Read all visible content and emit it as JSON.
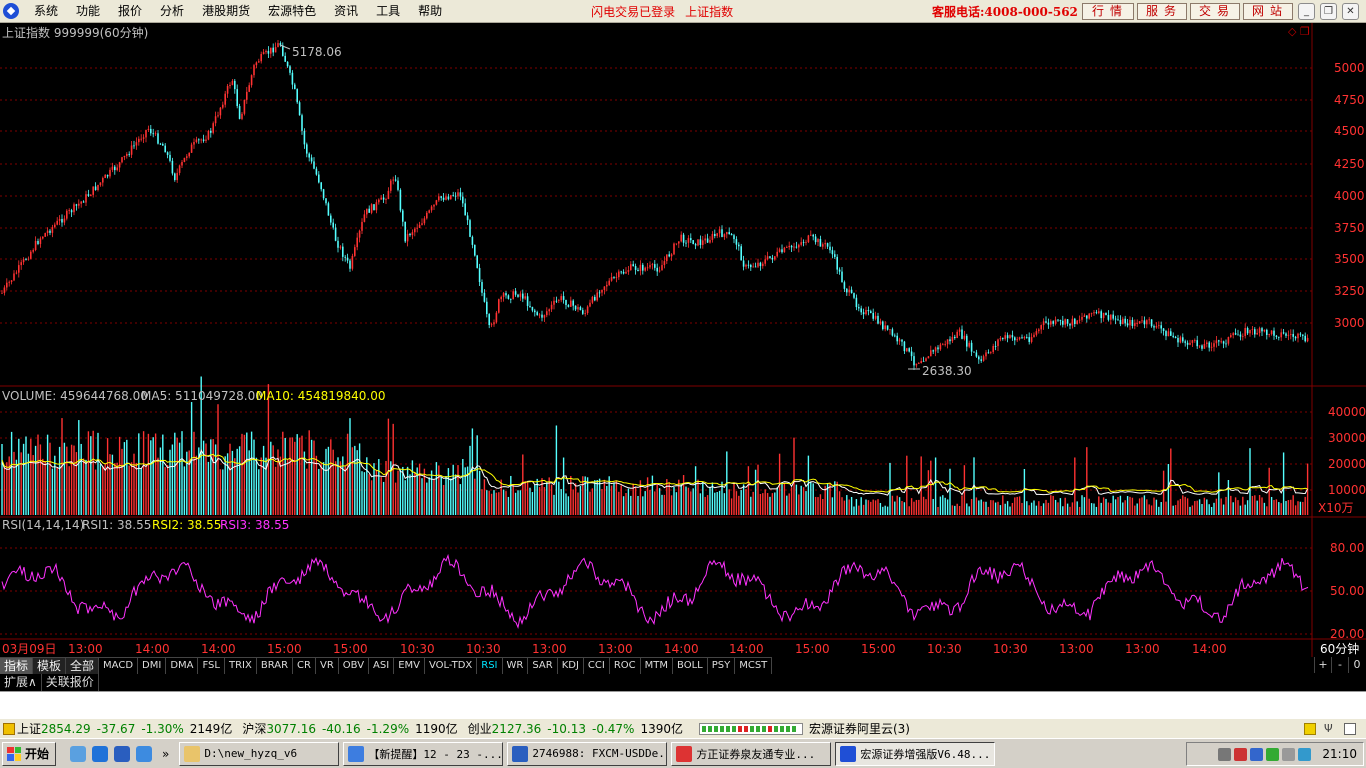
{
  "menubar": {
    "items": [
      "系统",
      "功能",
      "报价",
      "分析",
      "港股期货",
      "宏源特色",
      "资讯",
      "工具",
      "帮助"
    ],
    "login_status": "闪电交易已登录",
    "current_index": "上证指数",
    "hotline": "客服电话:4008-000-562",
    "quick_buttons": [
      "行情",
      "服务",
      "交易",
      "网站"
    ],
    "window_buttons": [
      "minimize",
      "restore",
      "close"
    ]
  },
  "price_panel": {
    "title": "上证指数 999999(60分钟)",
    "high_label": "5178.06",
    "low_label": "2638.30",
    "y_ticks": [
      "5000",
      "4750",
      "4500",
      "4250",
      "4000",
      "3750",
      "3500",
      "3250",
      "3000"
    ],
    "corner_icons": [
      "diamond-icon",
      "restore-panel-icon"
    ]
  },
  "volume_panel": {
    "label": "VOLUME: 459644768.00",
    "ma5": "MA5: 511049728.00",
    "ma10": "MA10: 454819840.00",
    "y_ticks": [
      "40000",
      "30000",
      "20000",
      "10000"
    ],
    "unit": "X10万"
  },
  "rsi_panel": {
    "label": "RSI(14,14,14)",
    "rsi1": "RSI1: 38.55",
    "rsi2": "RSI2: 38.55",
    "rsi3": "RSI3: 38.55",
    "y_ticks": [
      "80.00",
      "50.00",
      "20.00"
    ]
  },
  "time_axis": {
    "labels": [
      "03月09日",
      "13:00",
      "14:00",
      "14:00",
      "15:00",
      "15:00",
      "10:30",
      "10:30",
      "13:00",
      "13:00",
      "14:00",
      "14:00",
      "15:00",
      "15:00",
      "10:30",
      "10:30",
      "13:00",
      "13:00",
      "14:00"
    ],
    "period": "60分钟"
  },
  "indicator_bar": {
    "tabs": [
      "指标",
      "模板",
      "全部"
    ],
    "indicators": [
      "MACD",
      "DMI",
      "DMA",
      "FSL",
      "TRIX",
      "BRAR",
      "CR",
      "VR",
      "OBV",
      "ASI",
      "EMV",
      "VOL-TDX",
      "RSI",
      "WR",
      "SAR",
      "KDJ",
      "CCI",
      "ROC",
      "MTM",
      "BOLL",
      "PSY",
      "MCST"
    ],
    "selected": "RSI",
    "controls": [
      "+",
      "-",
      "0"
    ]
  },
  "expand_bar": {
    "items": [
      "扩展∧",
      "关联报价"
    ]
  },
  "index_bar": {
    "indices": [
      {
        "name": "上证",
        "value": "2854.29",
        "change": "-37.67",
        "pct": "-1.30%",
        "amount": "2149亿"
      },
      {
        "name": "沪深",
        "value": "3077.16",
        "change": "-40.16",
        "pct": "-1.29%",
        "amount": "1190亿"
      },
      {
        "name": "创业",
        "value": "2127.36",
        "change": "-10.13",
        "pct": "-0.47%",
        "amount": "1390亿"
      }
    ],
    "server": "宏源证券阿里云(3)"
  },
  "taskbar": {
    "start": "开始",
    "tasks": [
      "D:\\new_hyzq_v6",
      "【新提醒】12 - 23 -...",
      "2746988: FXCM-USDDe...",
      "方正证券泉友通专业...",
      "宏源证券增强版V6.48..."
    ],
    "clock": "21:10"
  },
  "colors": {
    "up": "#ff3232",
    "down": "#54ffff",
    "grid": "#800000",
    "ma5": "#ffffff",
    "ma10": "#ffff00",
    "rsi": "#ff33ff"
  }
}
